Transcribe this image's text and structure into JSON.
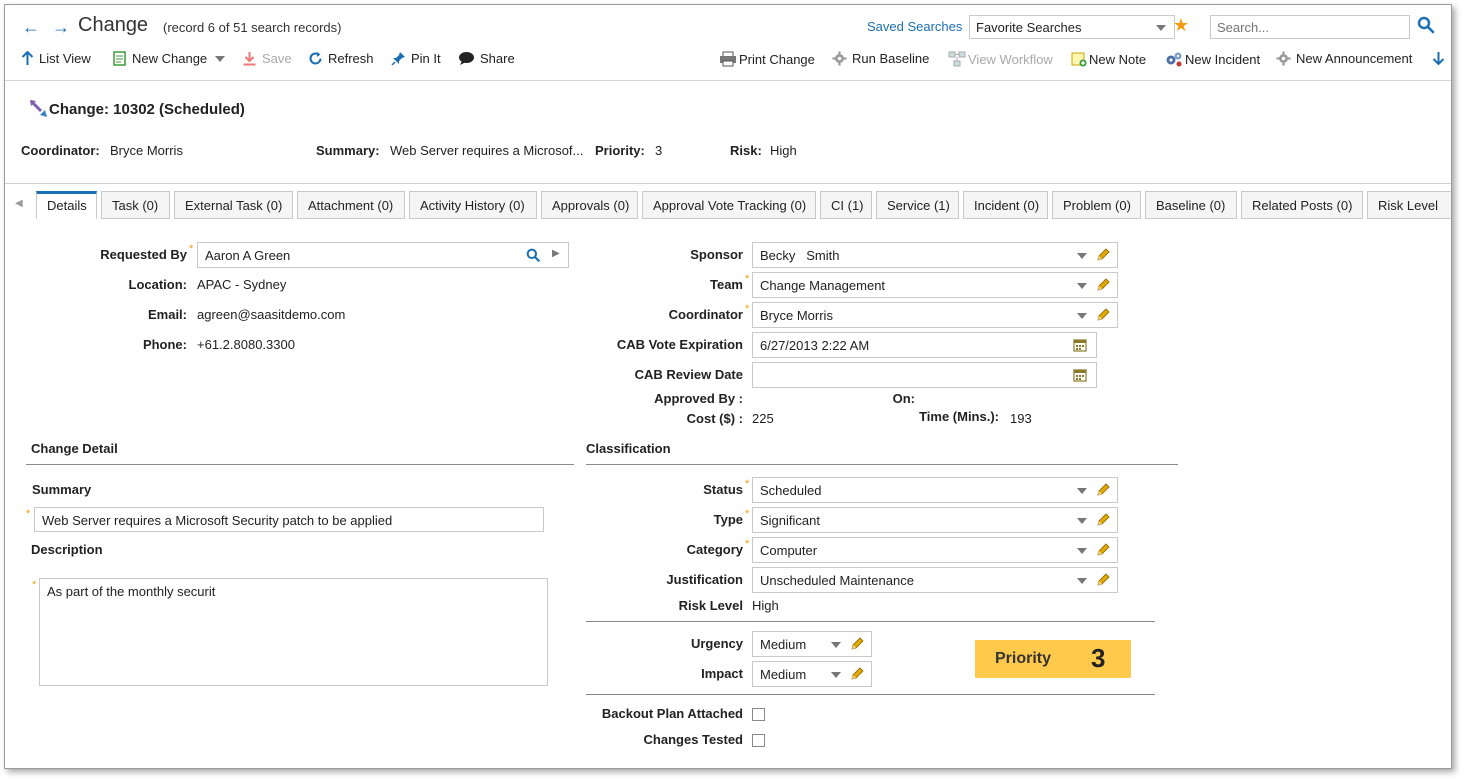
{
  "header": {
    "title": "Change",
    "record_info": "(record 6 of 51 search records)",
    "saved_searches": "Saved Searches",
    "favorite_searches": "Favorite Searches",
    "search_placeholder": "Search..."
  },
  "toolbar": {
    "list_view": "List View",
    "new_change": "New Change",
    "save": "Save",
    "refresh": "Refresh",
    "pin_it": "Pin It",
    "share": "Share",
    "print_change": "Print Change",
    "run_baseline": "Run Baseline",
    "view_workflow": "View Workflow",
    "new_note": "New Note",
    "new_incident": "New Incident",
    "new_announcement": "New Announcement"
  },
  "record": {
    "title": "Change: 10302 (Scheduled)",
    "coordinator_label": "Coordinator:",
    "coordinator": "Bryce Morris",
    "summary_label": "Summary:",
    "summary": "Web Server requires a Microsof...",
    "priority_label": "Priority:",
    "priority": "3",
    "risk_label": "Risk:",
    "risk": "High"
  },
  "tabs": [
    {
      "label": "Details"
    },
    {
      "label": "Task (0)"
    },
    {
      "label": "External Task (0)"
    },
    {
      "label": "Attachment (0)"
    },
    {
      "label": "Activity History (0)"
    },
    {
      "label": "Approvals (0)"
    },
    {
      "label": "Approval Vote Tracking (0)"
    },
    {
      "label": "CI (1)"
    },
    {
      "label": "Service (1)"
    },
    {
      "label": "Incident (0)"
    },
    {
      "label": "Problem (0)"
    },
    {
      "label": "Baseline (0)"
    },
    {
      "label": "Related Posts (0)"
    },
    {
      "label": "Risk Level"
    }
  ],
  "details": {
    "requested_by_label": "Requested By",
    "requested_by": "Aaron A Green",
    "location_label": "Location:",
    "location": "APAC - Sydney",
    "email_label": "Email:",
    "email": "agreen@saasitdemo.com",
    "phone_label": "Phone:",
    "phone": "+61.2.8080.3300",
    "sponsor_label": "Sponsor",
    "sponsor": "Becky   Smith",
    "team_label": "Team",
    "team": "Change Management",
    "coordinator_label": "Coordinator",
    "coordinator": "Bryce Morris",
    "cab_vote_label": "CAB Vote Expiration",
    "cab_vote": "6/27/2013 2:22 AM",
    "cab_review_label": "CAB Review Date",
    "cab_review": "",
    "approved_by_label": "Approved By :",
    "on_label": "On:",
    "cost_label": "Cost ($) :",
    "cost": "225",
    "time_label": "Time (Mins.):",
    "time": "193"
  },
  "change_detail": {
    "section": "Change Detail",
    "summary_label": "Summary",
    "summary": "Web Server requires a Microsoft Security patch to be applied",
    "description_label": "Description",
    "description": "As part of the monthly securit"
  },
  "classification": {
    "section": "Classification",
    "status_label": "Status",
    "status": "Scheduled",
    "type_label": "Type",
    "type": "Significant",
    "category_label": "Category",
    "category": "Computer",
    "justification_label": "Justification",
    "justification": "Unscheduled Maintenance",
    "risk_level_label": "Risk Level",
    "risk_level": "High",
    "urgency_label": "Urgency",
    "urgency": "Medium",
    "impact_label": "Impact",
    "impact": "Medium",
    "priority_label": "Priority",
    "priority": "3",
    "backout_label": "Backout Plan Attached",
    "tested_label": "Changes Tested"
  },
  "colors": {
    "accent": "#1b6fb3",
    "required": "#f39c12",
    "priority_bg": "#ffc94c",
    "pencil": "#e0a800"
  }
}
